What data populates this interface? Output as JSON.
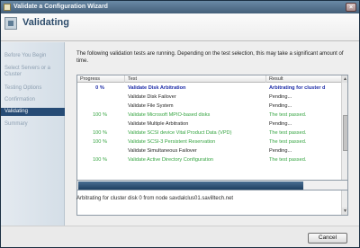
{
  "window": {
    "title": "Validate a Configuration Wizard",
    "close_label": "×"
  },
  "header": {
    "heading": "Validating"
  },
  "sidebar": {
    "items": [
      {
        "label": "Before You Begin"
      },
      {
        "label": "Select Servers or a"
      },
      {
        "label": "Cluster"
      },
      {
        "label": "Testing Options"
      },
      {
        "label": "Confirmation"
      },
      {
        "label": "Validating"
      },
      {
        "label": "Summary"
      }
    ],
    "active_index": 5
  },
  "main": {
    "description": "The following validation tests are running. Depending on the test selection, this may take a significant amount of time.",
    "columns": [
      "Progress",
      "Test",
      "Result"
    ],
    "rows": [
      {
        "progress": "0 %",
        "test": "Validate Disk Arbitration",
        "result": "Arbitrating for cluster d",
        "state": "active"
      },
      {
        "progress": "",
        "test": "Validate Disk Failover",
        "result": "Pending...",
        "state": "pending"
      },
      {
        "progress": "",
        "test": "Validate File System",
        "result": "Pending...",
        "state": "pending"
      },
      {
        "progress": "100 %",
        "test": "Validate Microsoft MPIO-based disks",
        "result": "The test passed.",
        "state": "done"
      },
      {
        "progress": "",
        "test": "Validate Multiple Arbitration",
        "result": "Pending...",
        "state": "pending"
      },
      {
        "progress": "100 %",
        "test": "Validate SCSI device Vital Product Data (VPD)",
        "result": "The test passed.",
        "state": "done"
      },
      {
        "progress": "100 %",
        "test": "Validate SCSI-3 Persistent Reservation",
        "result": "The test passed.",
        "state": "done"
      },
      {
        "progress": "",
        "test": "Validate Simultaneous Failover",
        "result": "Pending...",
        "state": "pending"
      },
      {
        "progress": "100 %",
        "test": "Validate Active Directory Configuration",
        "result": "The test passed.",
        "state": "done"
      }
    ],
    "overall_progress": 0.84,
    "status": "Arbitrating for cluster disk 0 from node savdalclus01.savilltech.net"
  },
  "footer": {
    "cancel_label": "Cancel"
  },
  "colors": {
    "passed": "#35a441",
    "active": "#1f2ea8",
    "selected_nav": "#264b75",
    "title_bar": "#445f79"
  }
}
